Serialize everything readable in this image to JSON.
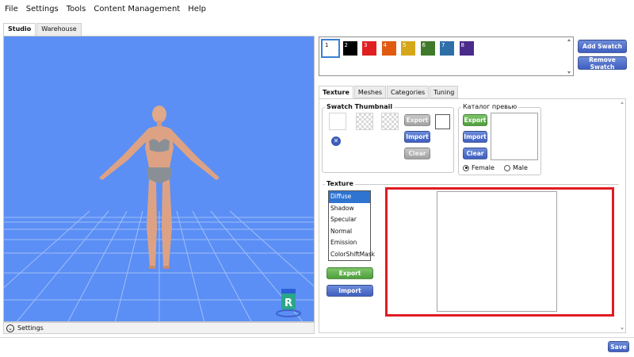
{
  "menu": [
    "File",
    "Settings",
    "Tools",
    "Content Management",
    "Help"
  ],
  "studio_tabs": [
    {
      "label": "Studio",
      "active": true
    },
    {
      "label": "Warehouse",
      "active": false
    }
  ],
  "viewport": {
    "settings_label": "Settings",
    "badge_letter": "R"
  },
  "swatches": [
    {
      "num": "1",
      "color": "#ffffff",
      "selected": true
    },
    {
      "num": "2",
      "color": "#000000",
      "selected": false
    },
    {
      "num": "3",
      "color": "#e02020",
      "selected": false
    },
    {
      "num": "4",
      "color": "#e05a10",
      "selected": false
    },
    {
      "num": "5",
      "color": "#d4a81a",
      "selected": false
    },
    {
      "num": "6",
      "color": "#3e7a2a",
      "selected": false
    },
    {
      "num": "7",
      "color": "#2e6fa8",
      "selected": false
    },
    {
      "num": "8",
      "color": "#4a2a8a",
      "selected": false
    }
  ],
  "swatch_buttons": {
    "add": "Add Swatch",
    "remove": "Remove Swatch"
  },
  "panel_tabs": [
    {
      "label": "Texture",
      "active": true
    },
    {
      "label": "Meshes",
      "active": false
    },
    {
      "label": "Categories",
      "active": false
    },
    {
      "label": "Tuning",
      "active": false
    }
  ],
  "swatch_thumbnail": {
    "title": "Swatch Thumbnail",
    "export": "Export",
    "import": "Import",
    "clear": "Clear"
  },
  "catalog": {
    "title": "Каталог превью",
    "export": "Export",
    "import": "Import",
    "clear": "Clear",
    "gender_options": [
      "Female",
      "Male"
    ],
    "selected_gender": "Female"
  },
  "texture": {
    "title": "Texture",
    "options": [
      "Diffuse",
      "Shadow",
      "Specular",
      "Normal",
      "Emission",
      "ColorShiftMask"
    ],
    "selected": "Diffuse",
    "export": "Export",
    "import": "Import"
  },
  "footer": {
    "save": "Save"
  },
  "colors": {
    "viewport_bg": "#5b8ff5",
    "highlight_frame": "#e11b22",
    "accent_blue": "#3f5fc0",
    "accent_green": "#4f9e3c"
  }
}
